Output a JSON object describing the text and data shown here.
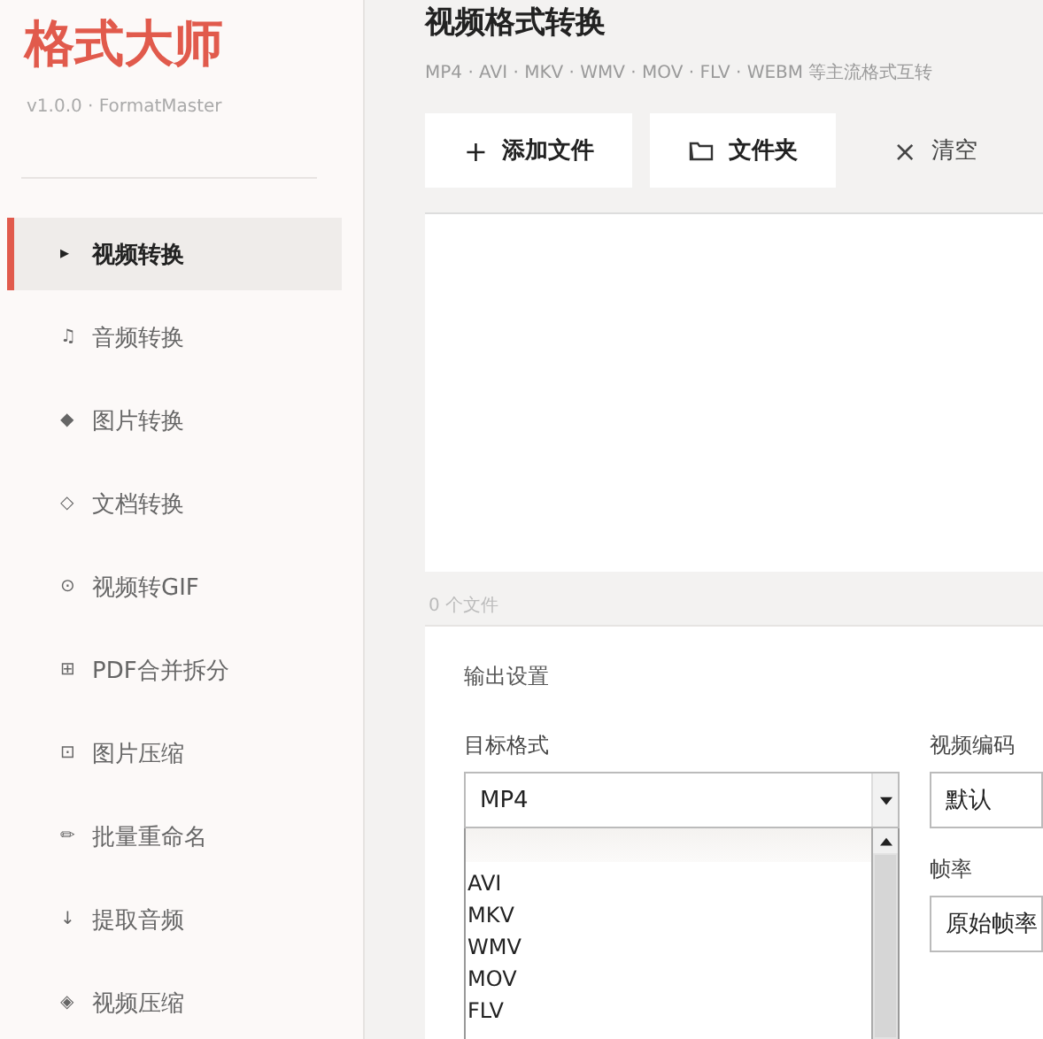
{
  "app": {
    "logo": "格式大师",
    "version": "v1.0.0 · FormatMaster"
  },
  "sidebar": {
    "items": [
      {
        "icon": "▸",
        "label": "视频转换",
        "selected": true
      },
      {
        "icon": "♫",
        "label": "音频转换",
        "selected": false
      },
      {
        "icon": "◆",
        "label": "图片转换",
        "selected": false
      },
      {
        "icon": "◇",
        "label": "文档转换",
        "selected": false
      },
      {
        "icon": "⊙",
        "label": "视频转GIF",
        "selected": false
      },
      {
        "icon": "⊞",
        "label": "PDF合并拆分",
        "selected": false
      },
      {
        "icon": "⊡",
        "label": "图片压缩",
        "selected": false
      },
      {
        "icon": "✏",
        "label": "批量重命名",
        "selected": false
      },
      {
        "icon": "↓",
        "label": "提取音频",
        "selected": false
      },
      {
        "icon": "◈",
        "label": "视频压缩",
        "selected": false
      }
    ]
  },
  "page": {
    "title": "视频格式转换",
    "subtitle": "MP4 · AVI · MKV · WMV · MOV · FLV · WEBM 等主流格式互转"
  },
  "toolbar": [
    {
      "kind": "add",
      "icon": "+",
      "label": "添加文件"
    },
    {
      "kind": "folder",
      "label": "文件夹"
    },
    {
      "kind": "clear",
      "icon": "×",
      "label": "清空"
    }
  ],
  "file_count": "0 个文件",
  "settings": {
    "title": "输出设置",
    "target_format": {
      "label": "目标格式",
      "value": "MP4",
      "expanded": true,
      "highlight_row": true,
      "options": [
        "AVI",
        "MKV",
        "WMV",
        "MOV",
        "FLV"
      ]
    },
    "video_codec": {
      "label": "视频编码",
      "value": "默认"
    },
    "frame_rate": {
      "label": "帧率",
      "value": "原始帧率"
    }
  }
}
